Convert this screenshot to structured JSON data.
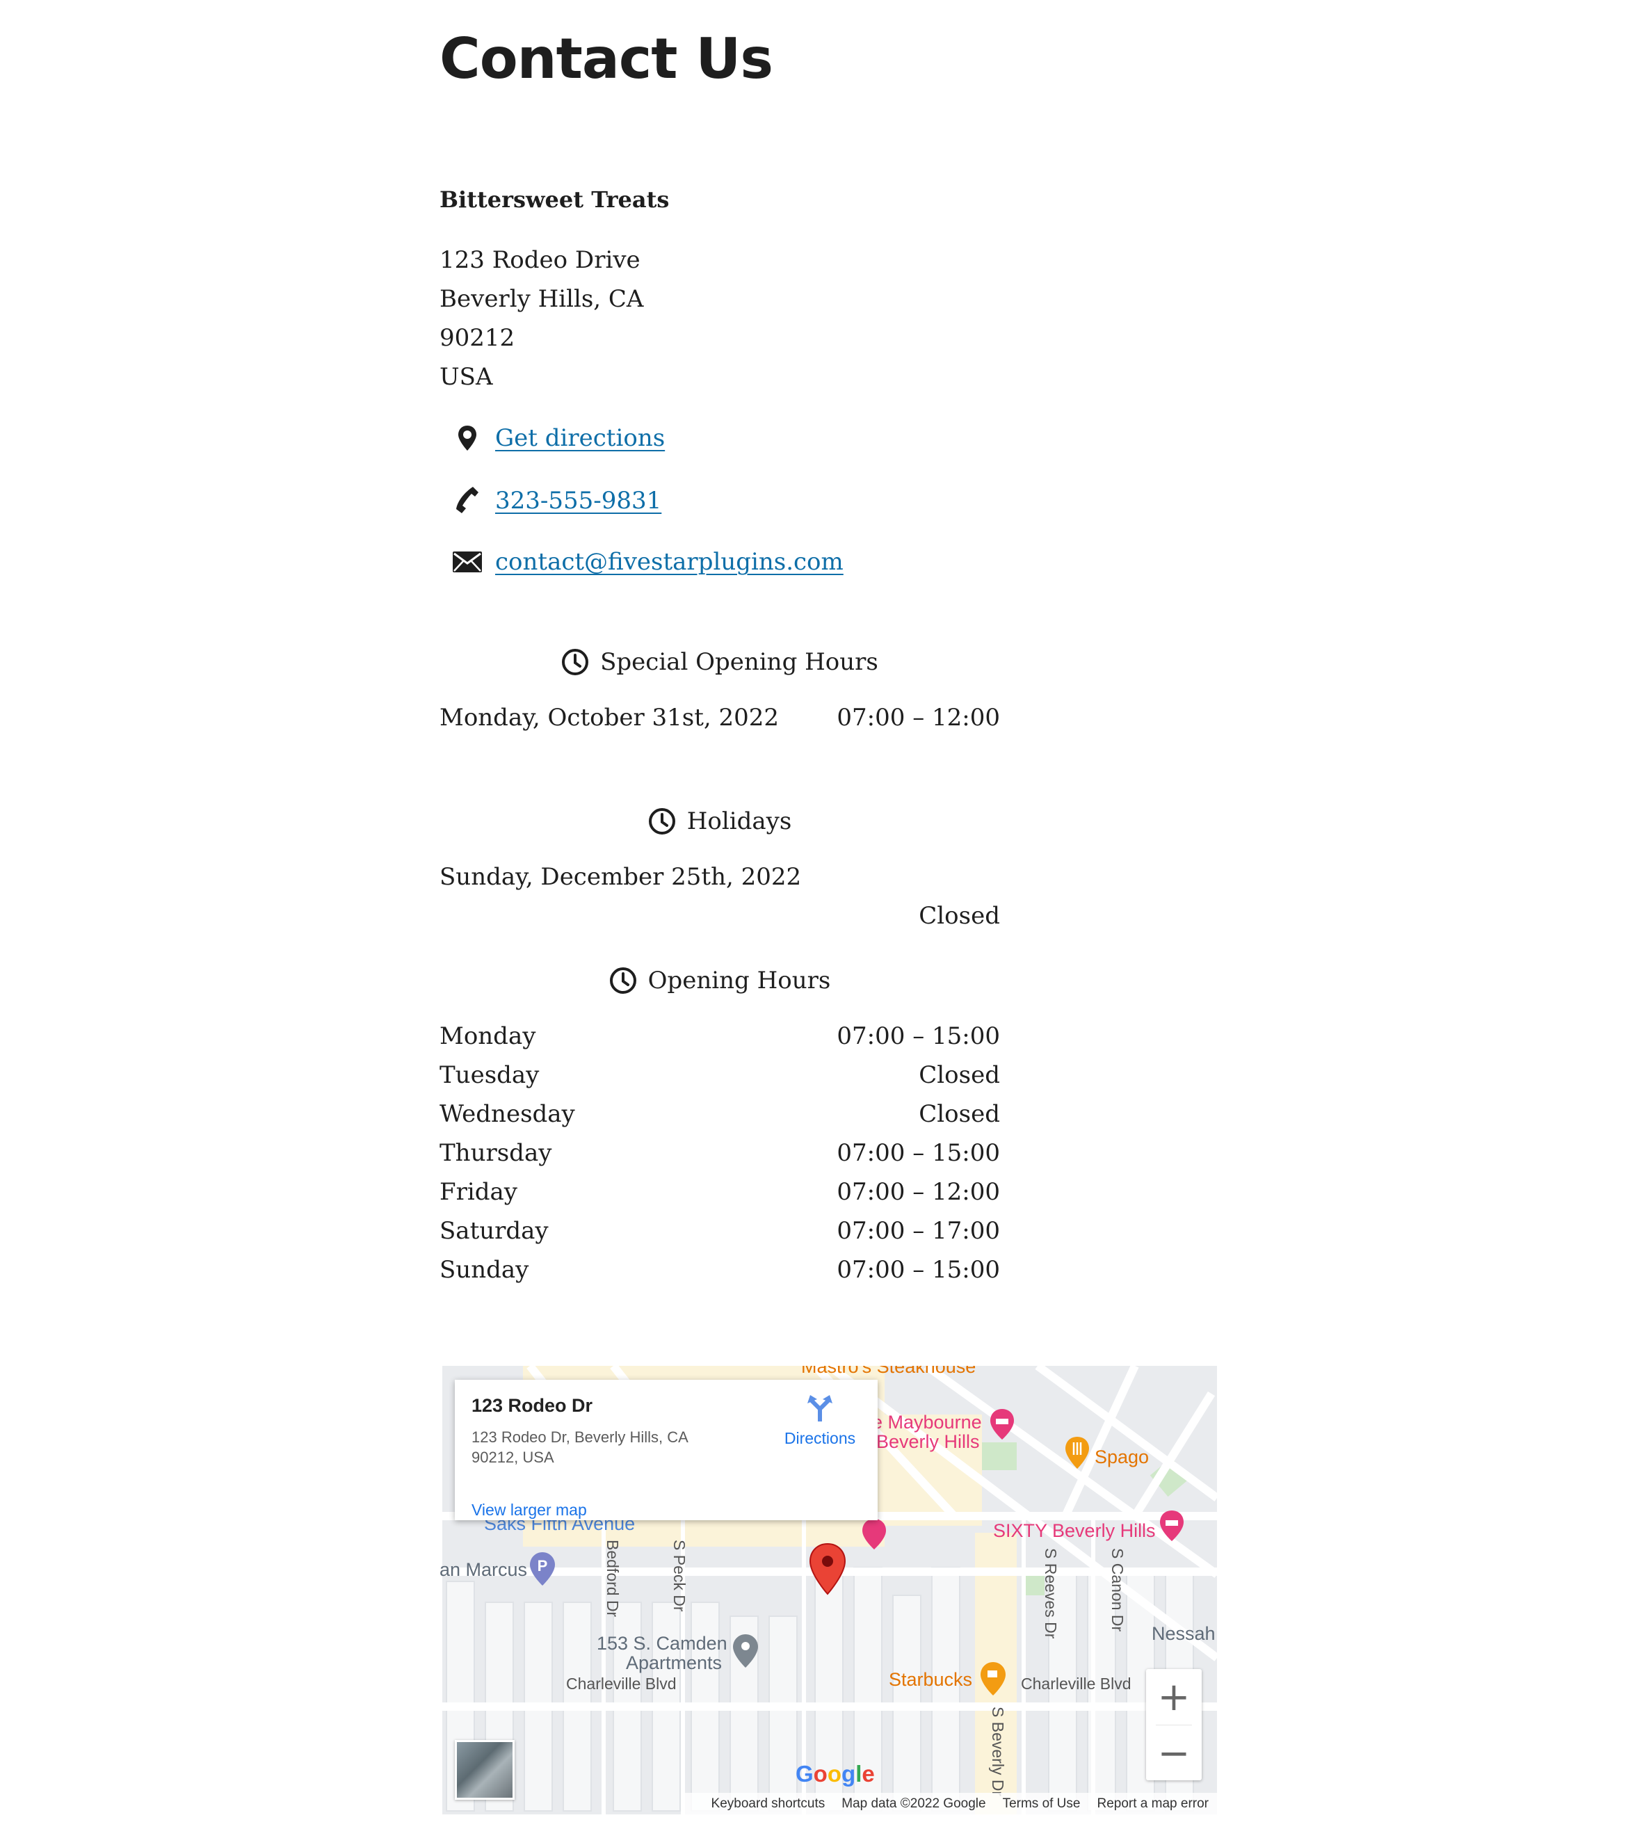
{
  "page": {
    "title": "Contact Us"
  },
  "business": {
    "name": "Bittersweet Treats",
    "address_lines": [
      "123 Rodeo Drive",
      "Beverly Hills, CA",
      "90212",
      "USA"
    ]
  },
  "contact": {
    "directions_label": "Get directions",
    "phone": "323-555-9831",
    "email": "contact@fivestarplugins.com"
  },
  "special_hours": {
    "title": "Special Opening Hours",
    "rows": [
      {
        "day": "Monday, October 31st, 2022",
        "time": "07:00 – 12:00"
      }
    ]
  },
  "holidays": {
    "title": "Holidays",
    "rows": [
      {
        "day": "Sunday, December 25th, 2022",
        "time": "Closed"
      }
    ]
  },
  "opening_hours": {
    "title": "Opening Hours",
    "rows": [
      {
        "day": "Monday",
        "time": "07:00 – 15:00"
      },
      {
        "day": "Tuesday",
        "time": "Closed"
      },
      {
        "day": "Wednesday",
        "time": "Closed"
      },
      {
        "day": "Thursday",
        "time": "07:00 – 15:00"
      },
      {
        "day": "Friday",
        "time": "07:00 – 12:00"
      },
      {
        "day": "Saturday",
        "time": "07:00 – 17:00"
      },
      {
        "day": "Sunday",
        "time": "07:00 – 15:00"
      }
    ]
  },
  "map": {
    "info": {
      "name": "123 Rodeo Dr",
      "address": "123 Rodeo Dr, Beverly Hills, CA 90212, USA",
      "directions_label": "Directions",
      "larger_map_label": "View larger map"
    },
    "pois": {
      "mastros": "Mastro's Steakhouse",
      "maybourne": "e Maybourne",
      "maybourne2": "Beverly Hills",
      "spago": "Spago",
      "sixty": "SIXTY Beverly Hills",
      "saks": "Saks Fifth Avenue",
      "neiman": "an Marcus",
      "camden": "153 S. Camden",
      "camden2": "Apartments",
      "starbucks": "Starbucks",
      "nessah": "Nessah"
    },
    "streets": {
      "bedford": "Bedford Dr",
      "peck": "S Peck Dr",
      "reeves": "S Reeves Dr",
      "canon": "S Canon Dr",
      "charleville1": "Charleville Blvd",
      "charleville2": "Charleville Blvd",
      "beverly": "S Beverly Dr"
    },
    "zoom_in": "+",
    "zoom_out": "−",
    "google_logo": "Google",
    "footer": {
      "shortcuts": "Keyboard shortcuts",
      "data": "Map data ©2022 Google",
      "terms": "Terms of Use",
      "report": "Report a map error"
    },
    "colors": {
      "red_pin": "#ea4335",
      "pink_poi": "#e6397a",
      "orange_poi": "#e37400",
      "blue_poi": "#4b84d8",
      "gray_poi": "#5f6b78"
    }
  }
}
